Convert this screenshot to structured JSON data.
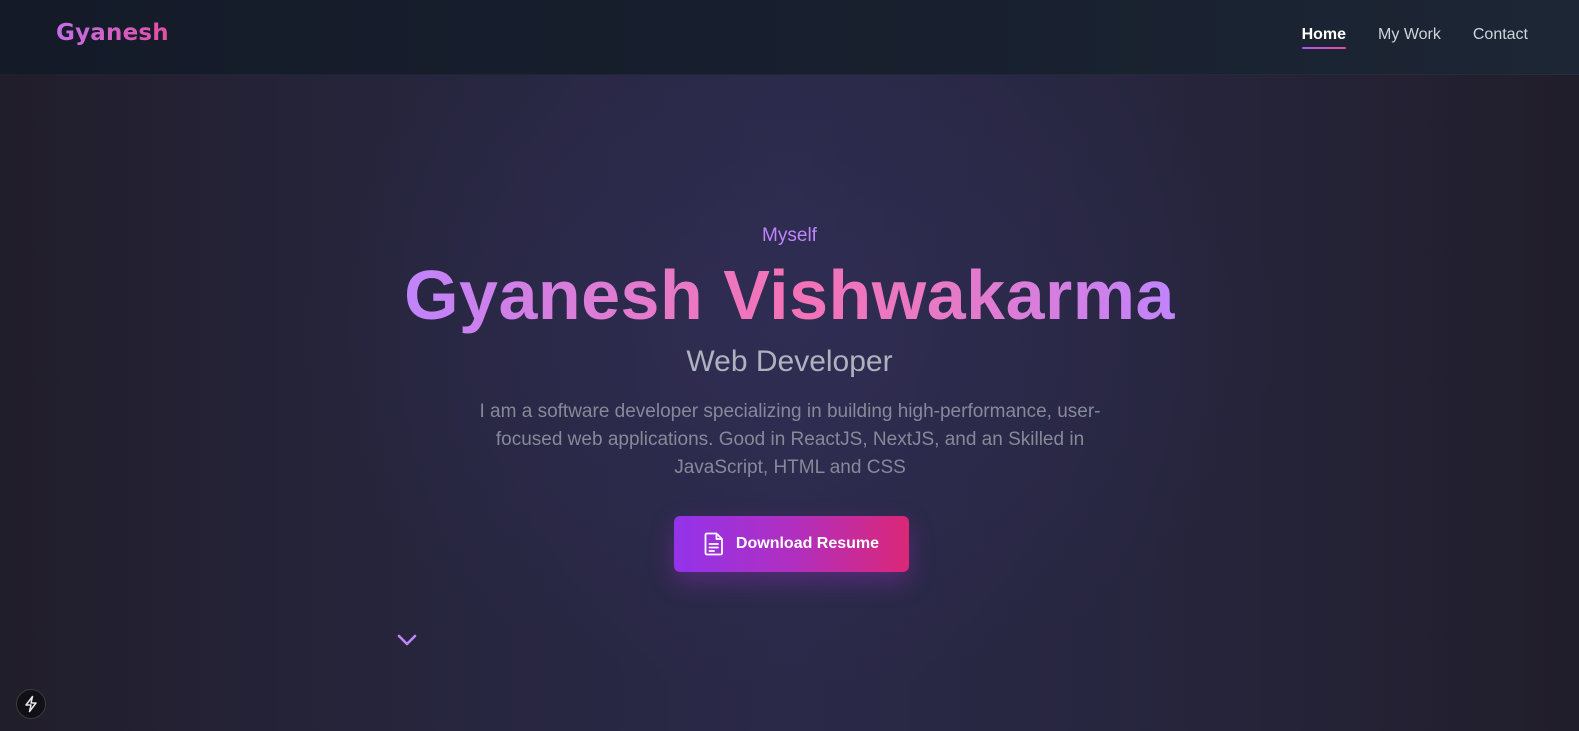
{
  "nav": {
    "brand": "Gyanesh",
    "links": [
      {
        "label": "Home",
        "active": true
      },
      {
        "label": "My Work",
        "active": false
      },
      {
        "label": "Contact",
        "active": false
      }
    ]
  },
  "hero": {
    "eyebrow": "Myself",
    "name": "Gyanesh Vishwakarma",
    "role": "Web Developer",
    "bio": "I am a software developer specializing in building high-performance, user-focused web applications. Good in ReactJS, NextJS, and an Skilled in JavaScript, HTML and CSS",
    "cta_label": "Download Resume",
    "cta_icon": "document-icon",
    "scroll_icon": "chevron-down-icon"
  },
  "badge": {
    "icon": "lightning-bolt-icon"
  },
  "colors": {
    "accent_purple": "#a855f7",
    "accent_pink": "#ec4899",
    "eyebrow": "#c084fc",
    "background": "#27263f",
    "nav_background": "#161d2b"
  }
}
